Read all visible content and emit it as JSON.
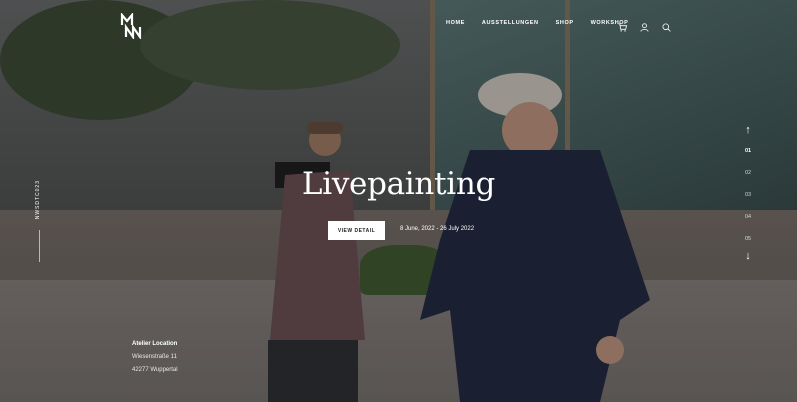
{
  "brand": {
    "logo_text": "MN"
  },
  "nav": {
    "items": [
      "HOME",
      "AUSSTELLUNGEN",
      "SHOP",
      "WORKSHOP"
    ]
  },
  "icons": {
    "cart": "cart-icon",
    "user": "user-icon",
    "search": "search-icon"
  },
  "hero": {
    "title": "Livepainting",
    "button_label": "VIEW DETAIL",
    "dates": "8 June, 2022 - 26 July 2022",
    "side_label": "NWSDTC023"
  },
  "location": {
    "title": "Atelier Location",
    "street": "Wiesenstraße 11",
    "city": "42277 Wuppertal"
  },
  "slider": {
    "pages": [
      "01",
      "02",
      "03",
      "04",
      "05"
    ],
    "active": "01"
  }
}
